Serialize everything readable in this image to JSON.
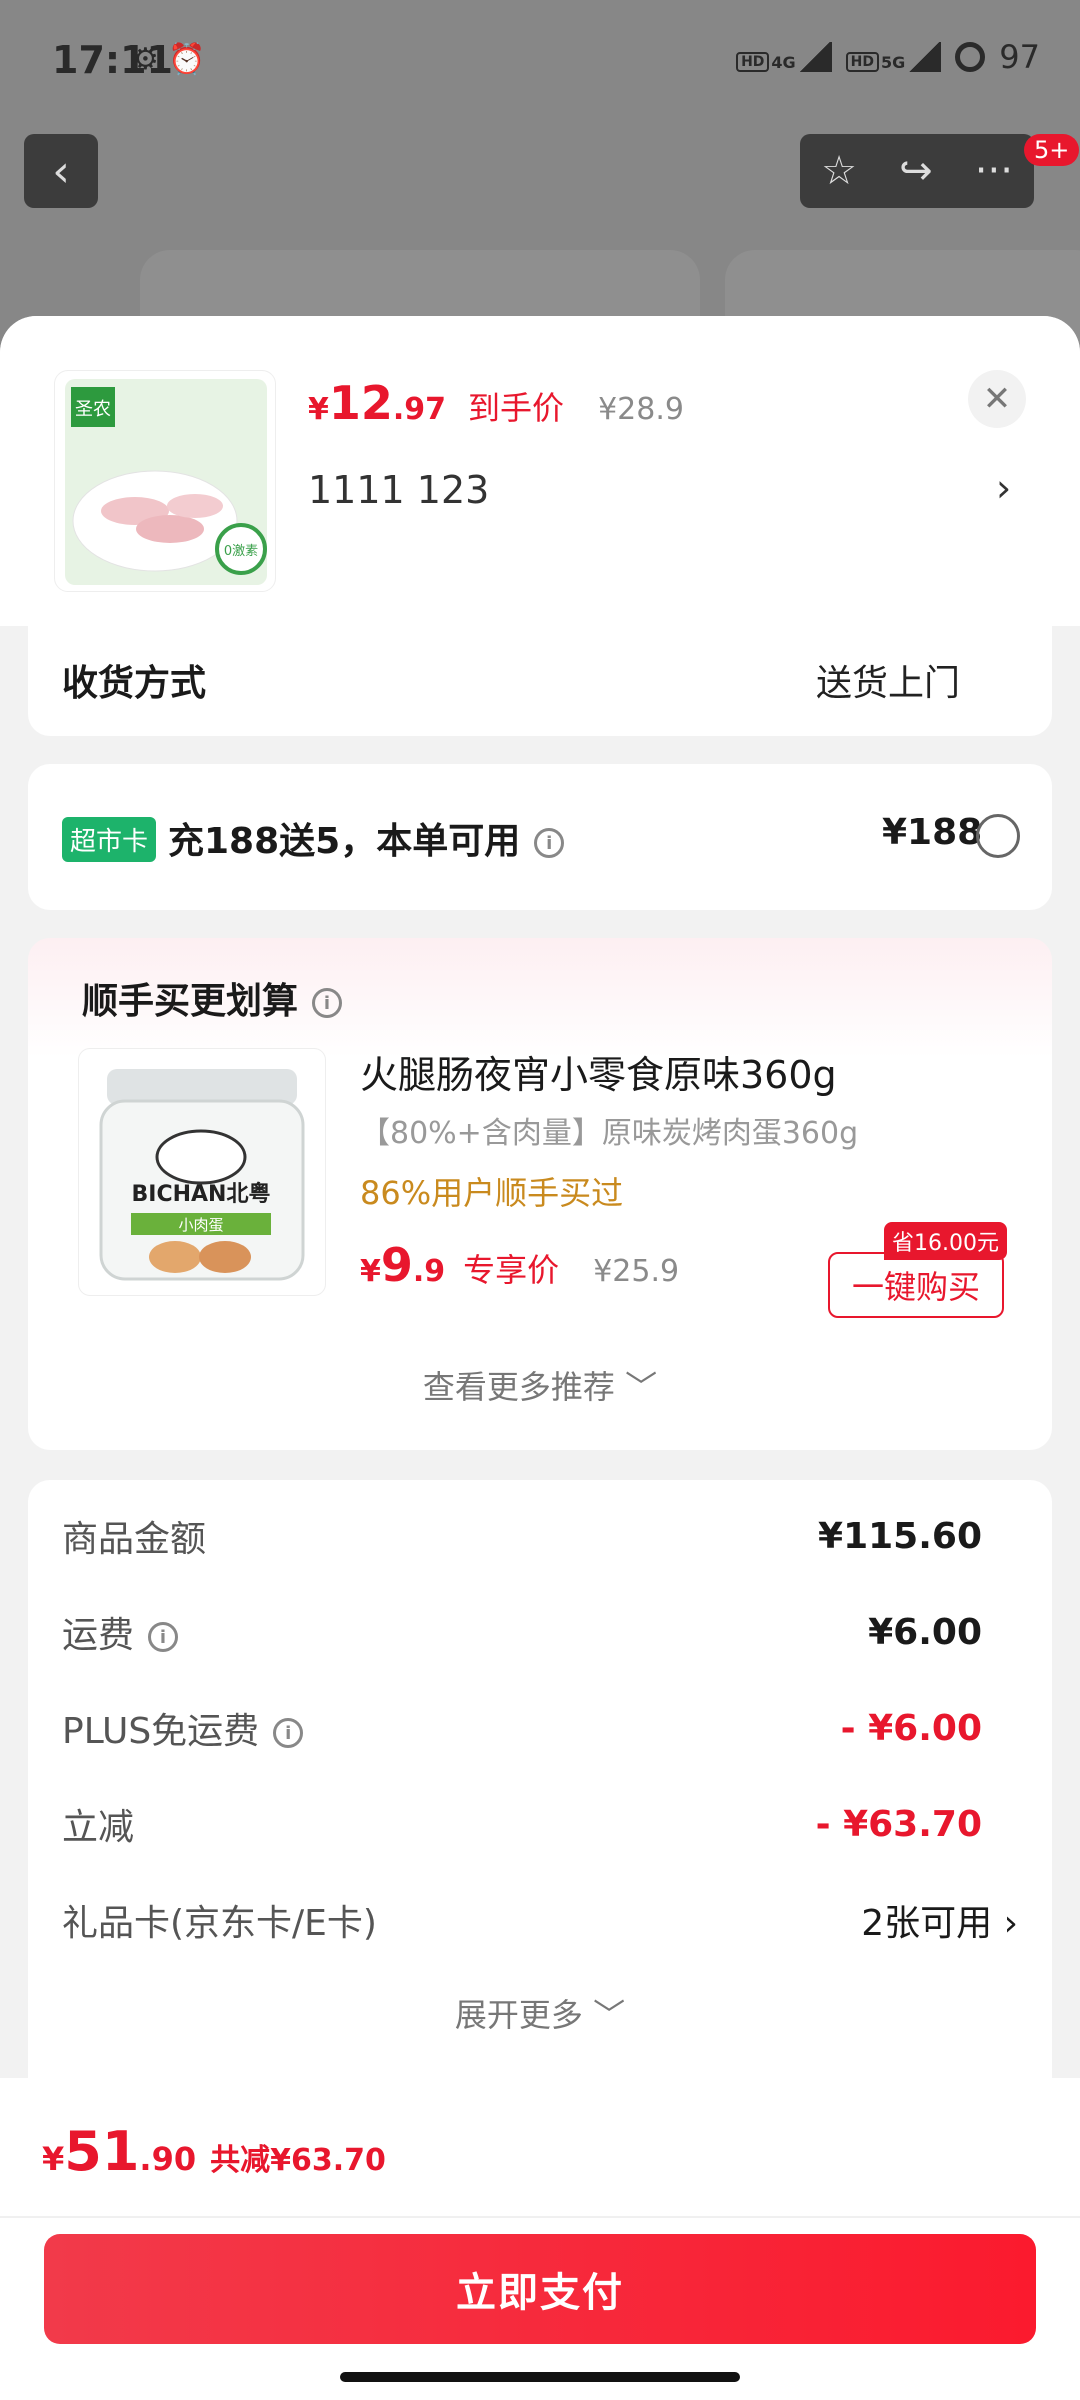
{
  "status_bar": {
    "time": "17:11",
    "icons": "⚙ ⏰",
    "net1": "4G",
    "net2": "5G",
    "battery": "97"
  },
  "nav": {
    "back_glyph": "‹",
    "star_glyph": "☆",
    "share_glyph": "↪",
    "more_glyph": "···",
    "badge": "5+"
  },
  "product": {
    "price_symbol": "¥",
    "price_int": "12",
    "price_dec": ".97",
    "price_tag": "到手价",
    "original_price": "¥28.9",
    "spec": "1111  123",
    "spec_chevron": "›",
    "close_glyph": "✕",
    "image_brand": "圣农",
    "image_badge": "0激素"
  },
  "delivery": {
    "label": "收货方式",
    "value": "送货上门"
  },
  "member_card": {
    "badge": "超市卡",
    "text": "充188送5，本单可用",
    "info_glyph": "i",
    "price": "¥188"
  },
  "recommend": {
    "title": "顺手买更划算",
    "info_glyph": "i",
    "item_title": "火腿肠夜宵小零食原味360g",
    "item_sub": "【80%+含肉量】原味炭烤肉蛋360g",
    "item_stat": "86%用户顺手买过",
    "price_symbol": "¥",
    "price_int": "9",
    "price_dec": ".9",
    "price_tag": "专享价",
    "original_price": "¥25.9",
    "save_tag": "省16.00元",
    "buy_label": "一键购买",
    "more_label": "查看更多推荐 ﹀",
    "image_brand": "BICHAN北粤",
    "image_label": "小肉蛋"
  },
  "summary": {
    "rows": [
      {
        "label": "商品金额",
        "value": "¥115.60"
      },
      {
        "label": "运费",
        "value": "¥6.00"
      },
      {
        "label": "PLUS免运费",
        "value": "- ¥6.00"
      },
      {
        "label": "立减",
        "value": "- ¥63.70"
      },
      {
        "label": "礼品卡(京东卡/E卡)",
        "value": "2张可用 ›"
      }
    ],
    "info_glyph": "i",
    "expand_label": "展开更多 ﹀"
  },
  "footer": {
    "total_symbol": "¥",
    "total_int": "51",
    "total_dec": ".90",
    "total_save": "共减¥63.70",
    "pay_label": "立即支付"
  },
  "colors": {
    "accent": "#e8172d",
    "badge_green": "#1db36b",
    "stat_orange": "#c98a1e"
  }
}
